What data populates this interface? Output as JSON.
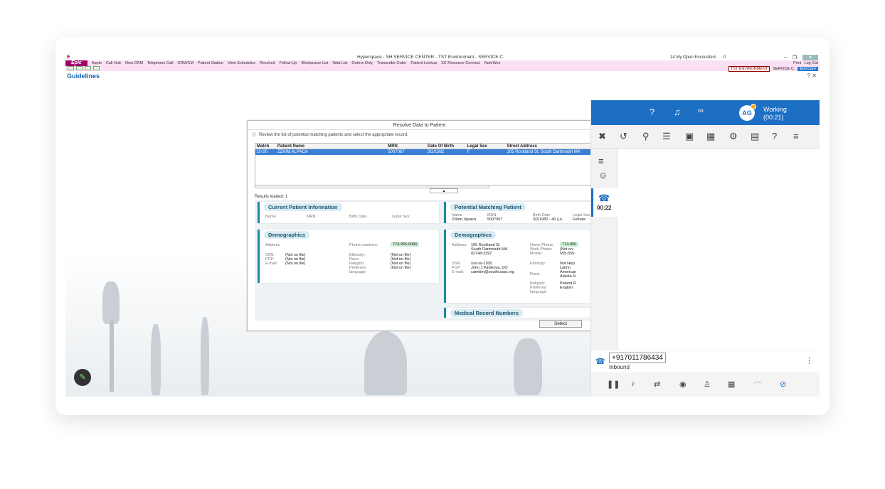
{
  "window": {
    "title": "Hyperspace - SH SERVICE CENTER - TST Environment - SERVICE C.",
    "encounters": "14  My Open Encounters",
    "mail": "0"
  },
  "toolbar": {
    "brand": "Epic",
    "items": [
      "Appts",
      "Call Hub",
      "New CRM",
      "Telephone Call",
      "CRM/CM",
      "Patient Station",
      "View Schedules",
      "Resched",
      "Follow-Up",
      "Workqueue List",
      "Wait List",
      "Orders Only",
      "Transcribe Order",
      "Patient Lookup",
      "SC Resource Connect",
      "NoteWox"
    ],
    "print": "Print",
    "logout": "Log Out",
    "env": "TST ENVIRONMENT",
    "service": "SERVICE C.",
    "epiccare": "EpicCare"
  },
  "page": {
    "title": "Guidelines"
  },
  "dialog": {
    "title": "Resolve Data to Patient",
    "instruction": "Review the list of potential matching patients and select the appropriate record.",
    "columns": [
      "Match",
      "Patient Name",
      "MRN",
      "Date Of Birth",
      "Legal Sex",
      "Street Address"
    ],
    "rows": [
      [
        "10.00",
        "ZZKIM,ALPACA",
        "5007067",
        "3/2/1982",
        "F",
        "105 Rockland St, South Dartmouth MA"
      ]
    ],
    "results": "Results loaded: 1",
    "select_label": "Select",
    "current": {
      "header": "Current Patient Information",
      "cols": [
        "Name",
        "MRN",
        "Birth Date",
        "Legal Sex"
      ]
    },
    "demographics_left": {
      "header": "Demographics",
      "address_label": "Address:",
      "phone_label": "Phone numbers:",
      "phone_value": "774-955-6080",
      "labels": [
        "SSN:",
        "PCP:",
        "E-mail:"
      ],
      "values": [
        "(Not on file)",
        "(Not on file)",
        "(Not on file)"
      ],
      "labels2": [
        "Ethnicity:",
        "Race:",
        "Religion:",
        "Preferred",
        "language:"
      ],
      "values2": [
        "(Not on file)",
        "(Not on file)",
        "(Not on file)",
        "(Not on file)"
      ]
    },
    "potential": {
      "header": "Potential Matching Patient",
      "cols": [
        "Name",
        "MRN",
        "Birth Date",
        "Legal Sex"
      ],
      "name": "Zzkim, Alpaca",
      "mrn": "5007067",
      "dob": "3/2/1982 - 40 y.o.",
      "sex": "Female"
    },
    "demographics_right": {
      "header": "Demographics",
      "address_label": "Address:",
      "address": [
        "105 Rockland St",
        "South Dartmouth MA",
        "02748-3397"
      ],
      "home_label": "Home Phone:",
      "home_value": "774-955",
      "work_label": "Work Phone:",
      "work_value": "(Not on",
      "mobile_label": "Mobile:",
      "mobile_value": "555-555-",
      "ssn_label": "SSN:",
      "ssn": "xxx-xx-1300",
      "pcp_label": "PCP:",
      "pcp": "John J Padikova, DO",
      "email_label": "E-mail:",
      "email": "camkim@southcoast.org",
      "ethnicity_label": "Ethnicity:",
      "ethnicity": [
        "Not Hisp",
        "Latino"
      ],
      "race_label": "Race:",
      "race": [
        "American",
        "Alaska N"
      ],
      "religion_label": "Religion:",
      "religion": "Patient R",
      "lang_label": [
        "Preferred",
        "language:"
      ],
      "lang": "English"
    },
    "mrn_header": "Medical Record Numbers"
  },
  "panel": {
    "status": "Working",
    "timer": "(00:21)",
    "avatar": "AG",
    "call_timer": "00:22",
    "phone": "+917011786434",
    "direction": "Inbound"
  }
}
